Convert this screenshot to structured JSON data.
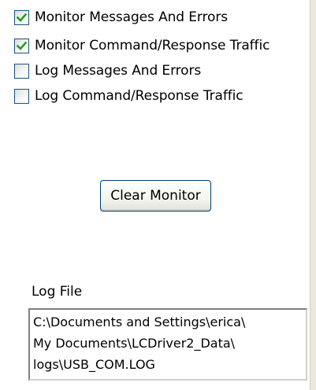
{
  "options": [
    {
      "label": "Monitor Messages And Errors",
      "checked": true
    },
    {
      "label": "Monitor Command/Response Traffic",
      "checked": true
    },
    {
      "label": "Log Messages And Errors",
      "checked": false
    },
    {
      "label": "Log Command/Response Traffic",
      "checked": false
    }
  ],
  "clear_button_label": "Clear Monitor",
  "log_file": {
    "label": "Log File",
    "lines": [
      "C:\\Documents and Settings\\erica\\",
      "My Documents\\LCDriver2_Data\\",
      "logs\\USB_COM.LOG"
    ]
  },
  "colors": {
    "checkbox_border": "#1c5180",
    "checkmark": "#21a121",
    "button_border": "#003c74"
  }
}
